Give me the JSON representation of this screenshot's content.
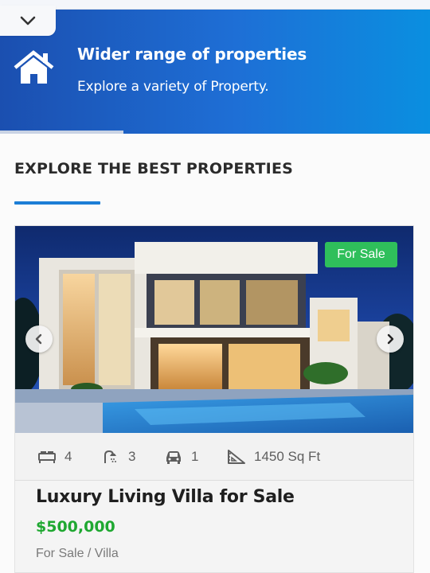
{
  "banner": {
    "title": "Wider range of properties",
    "subtitle": "Explore a variety of Property.",
    "icon": "home-icon",
    "collapse_icon": "chevron-down-icon",
    "colors": {
      "gradient_start": "#1b4fb0",
      "gradient_end": "#0a8fe0"
    }
  },
  "section": {
    "title": "EXPLORE THE BEST PROPERTIES",
    "accent_color": "#1c7ed6"
  },
  "listing": {
    "badge": "For Sale",
    "badge_color": "#2fbf5b",
    "carousel": {
      "prev_icon": "chevron-left-icon",
      "next_icon": "chevron-right-icon"
    },
    "features": {
      "beds": {
        "icon": "bed-icon",
        "value": "4"
      },
      "baths": {
        "icon": "shower-icon",
        "value": "3"
      },
      "garage": {
        "icon": "car-icon",
        "value": "1"
      },
      "area": {
        "icon": "ruler-triangle-icon",
        "value": "1450 Sq Ft"
      }
    },
    "title": "Luxury Living Villa for Sale",
    "price": "$500,000",
    "price_color": "#1fa831",
    "category": "For Sale / Villa"
  }
}
